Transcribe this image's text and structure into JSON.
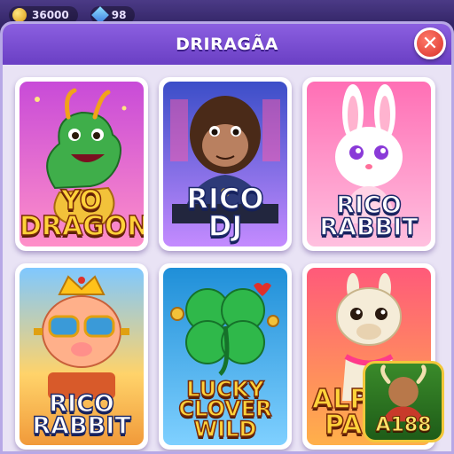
{
  "header": {
    "title": "DRIRAGÃA",
    "close_label": "✕"
  },
  "hud": {
    "coins": "36000",
    "items": "98"
  },
  "games": [
    {
      "line1": "YO",
      "line2": "DRAGON",
      "style": "yellow",
      "bg": [
        "#c84bd8",
        "#ff8fc8"
      ],
      "art": "dragon-icon"
    },
    {
      "line1": "RICO",
      "line2": "DJ",
      "style": "white",
      "bg": [
        "#3b4ec8",
        "#c48bff"
      ],
      "art": "gorilla-icon"
    },
    {
      "line1": "RICO",
      "line2": "RABBIT",
      "style": "white",
      "bg": [
        "#ff6fb5",
        "#ffc0df"
      ],
      "art": "rabbit-icon"
    },
    {
      "line1": "RICO",
      "line2": "RABBIT",
      "style": "white",
      "bg": [
        "#f19a3a",
        "#ffd36a"
      ],
      "art": "pig-icon"
    },
    {
      "line1": "LUCKY",
      "line2": "CLOVER",
      "line3": "WILD",
      "style": "yellow",
      "bg": [
        "#1f8fd8",
        "#7fd0ff"
      ],
      "art": "clover-icon"
    },
    {
      "line1": "ALP",
      "line2": "PA",
      "style": "yellow",
      "bg": [
        "#ff5a7a",
        "#ffb04a"
      ],
      "art": "llama-icon"
    }
  ],
  "badge": {
    "text": "A188"
  }
}
